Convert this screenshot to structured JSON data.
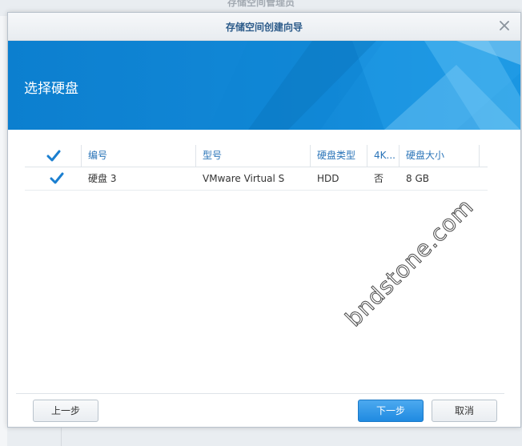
{
  "background": {
    "window_title": "存储空间管理员"
  },
  "dialog": {
    "title": "存储空间创建向导",
    "close_icon": "close-icon",
    "banner_title": "选择硬盘"
  },
  "table": {
    "columns": [
      "编号",
      "型号",
      "硬盘类型",
      "4K...",
      "硬盘大小"
    ],
    "rows": [
      {
        "checked": true,
        "number": "硬盘 3",
        "model": "VMware Virtual S",
        "type": "HDD",
        "four_k": "否",
        "size": "8 GB"
      }
    ],
    "select_all_checked": true
  },
  "buttons": {
    "back": "上一步",
    "next": "下一步",
    "cancel": "取消"
  },
  "watermark": "bndstone.com",
  "colors": {
    "accent": "#1187d6",
    "primary_button": "#2b93e6",
    "header_text": "#2a74b8"
  }
}
